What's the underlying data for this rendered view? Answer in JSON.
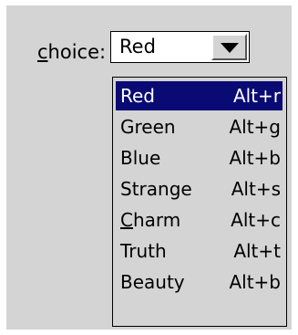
{
  "label": {
    "mnemonic": "c",
    "rest": "hoice:"
  },
  "combo": {
    "value": "Red"
  },
  "menu": {
    "items": [
      {
        "label": "Red",
        "accel": "Alt+r",
        "selected": true
      },
      {
        "label": "Green",
        "accel": "Alt+g"
      },
      {
        "label": "Blue",
        "accel": "Alt+b"
      },
      {
        "label": "Strange",
        "accel": "Alt+s"
      },
      {
        "label_mnemonic": "C",
        "label_rest": "harm",
        "accel": "Alt+c"
      },
      {
        "label": "Truth",
        "accel": "Alt+t"
      },
      {
        "label": "Beauty",
        "accel": "Alt+b"
      }
    ]
  },
  "colors": {
    "panel": "#d4d4d4",
    "selection": "#0a0a74",
    "selection_text": "#ffffff"
  }
}
